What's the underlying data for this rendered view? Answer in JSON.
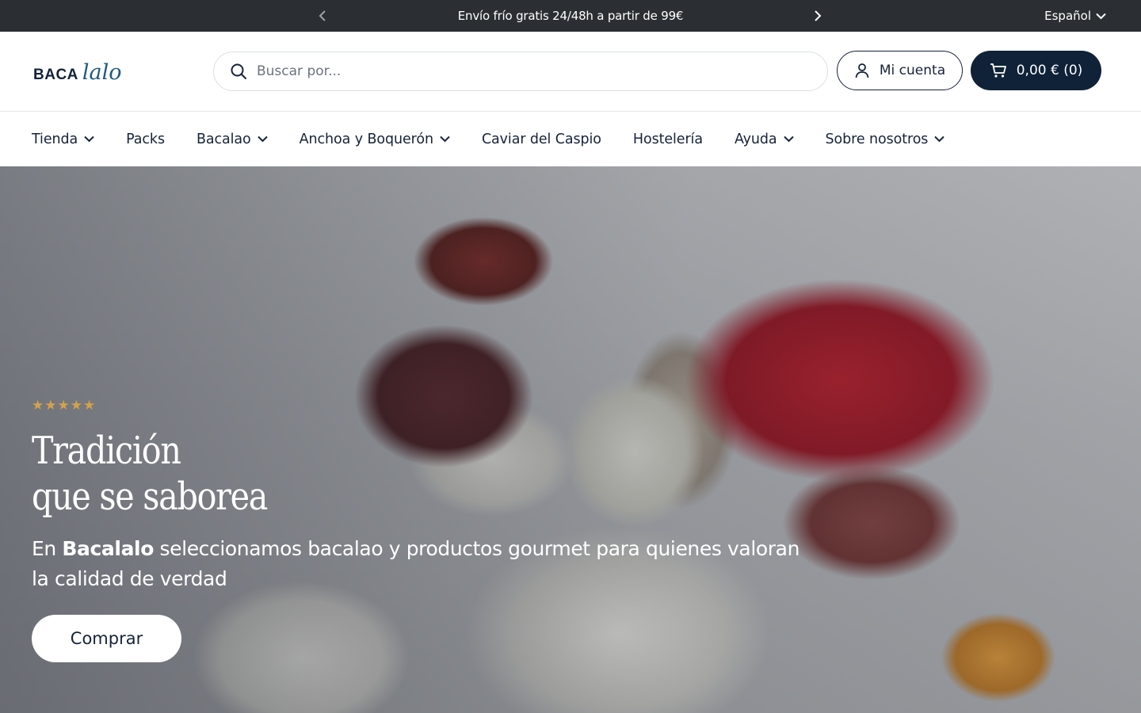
{
  "announcement": {
    "message": "Envío frío gratis 24/48h a partir de 99€",
    "language": "Español"
  },
  "header": {
    "logo_left": "BACA",
    "logo_right": "lalo",
    "search_placeholder": "Buscar por...",
    "account_label": "Mi cuenta",
    "cart_label": "0,00 € (0)"
  },
  "nav": {
    "items": [
      {
        "label": "Tienda",
        "dropdown": true
      },
      {
        "label": "Packs",
        "dropdown": false
      },
      {
        "label": "Bacalao",
        "dropdown": true
      },
      {
        "label": "Anchoa y Boquerón",
        "dropdown": true
      },
      {
        "label": "Caviar del Caspio",
        "dropdown": false
      },
      {
        "label": "Hostelería",
        "dropdown": false
      },
      {
        "label": "Ayuda",
        "dropdown": true
      },
      {
        "label": "Sobre nosotros",
        "dropdown": true
      }
    ]
  },
  "hero": {
    "rating": 5,
    "stars": "★★★★★",
    "title_line1": "Tradición",
    "title_line2": "que se saborea",
    "subtitle_prefix": "En ",
    "subtitle_brand": "Bacalalo",
    "subtitle_rest": " seleccionamos bacalao y productos gourmet para quienes valoran la calidad de verdad",
    "cta_label": "Comprar"
  },
  "colors": {
    "topbar_bg": "#2b2f33",
    "primary_navy": "#0f2238",
    "logo_blue": "#1d5b82",
    "star_gold": "#d4a24a"
  }
}
